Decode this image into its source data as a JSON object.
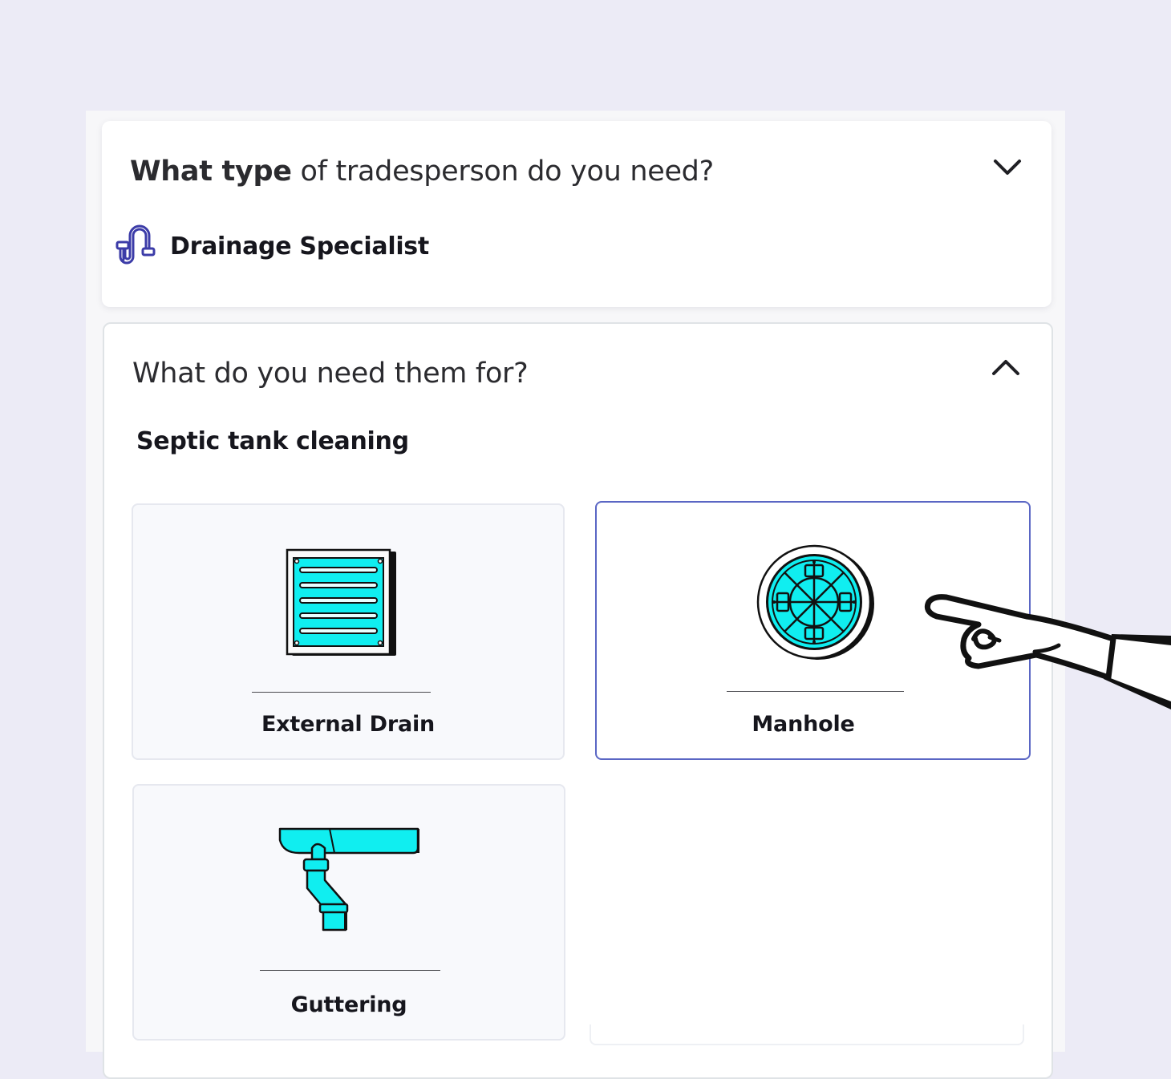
{
  "step1": {
    "question_bold": "What type",
    "question_rest": " of tradesperson do you need?",
    "selected_trade": "Drainage Specialist",
    "trade_icon": "pipe-trap-icon",
    "toggle_icon": "chevron-down-icon"
  },
  "step2": {
    "question": "What do you need them for?",
    "toggle_icon": "chevron-up-icon",
    "selected_job": "Septic tank cleaning",
    "options": [
      {
        "label": "External Drain",
        "icon": "drain-grate-icon",
        "selected": false
      },
      {
        "label": "Manhole",
        "icon": "manhole-cover-icon",
        "selected": true
      },
      {
        "label": "Guttering",
        "icon": "gutter-downpipe-icon",
        "selected": false
      }
    ]
  },
  "colors": {
    "accent": "#5a66c4",
    "illustration": "#10eef0",
    "background": "#ecebf6",
    "trade_icon": "#3c3ca8"
  }
}
